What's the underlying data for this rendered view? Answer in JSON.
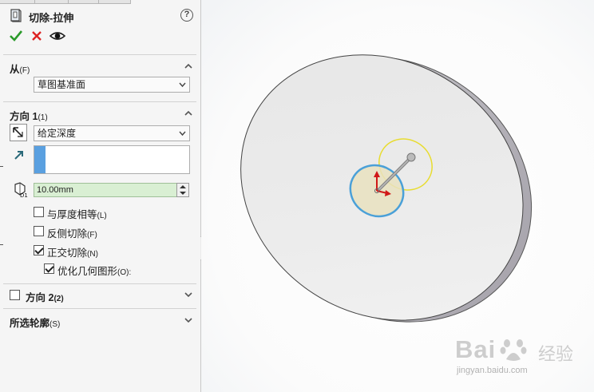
{
  "header": {
    "title": "切除-拉伸",
    "help_label": "?"
  },
  "actions": {
    "ok_icon": "checkmark-icon",
    "cancel_icon": "close-icon",
    "preview_icon": "eye-icon"
  },
  "from_section": {
    "title": "从",
    "shortcut": "(F)",
    "start_condition": "草图基准面"
  },
  "direction1_section": {
    "title": "方向 1",
    "shortcut": "(1)",
    "end_condition": "给定深度",
    "depth_value": "10.00mm",
    "depth_dim_label": "D1",
    "options": [
      {
        "label": "与厚度相等",
        "shortcut": "(L)",
        "checked": false
      },
      {
        "label": "反侧切除",
        "shortcut": "(F)",
        "checked": false
      },
      {
        "label": "正交切除",
        "shortcut": "(N)",
        "checked": true
      },
      {
        "label": "优化几何图形",
        "shortcut": "(O):",
        "checked": true
      }
    ]
  },
  "direction2_section": {
    "title": "方向 2",
    "shortcut": "(2)",
    "checked": false
  },
  "contours_section": {
    "title": "所选轮廓",
    "shortcut": "(S)"
  },
  "watermark": {
    "brand": "Bai",
    "brand_end": "经验",
    "url": "jingyan.baidu.com"
  },
  "colors": {
    "accent_blue": "#4a9ad8",
    "ok_green": "#2a9a2a",
    "cancel_red": "#dd2222",
    "depth_field": "#d9efd3"
  }
}
